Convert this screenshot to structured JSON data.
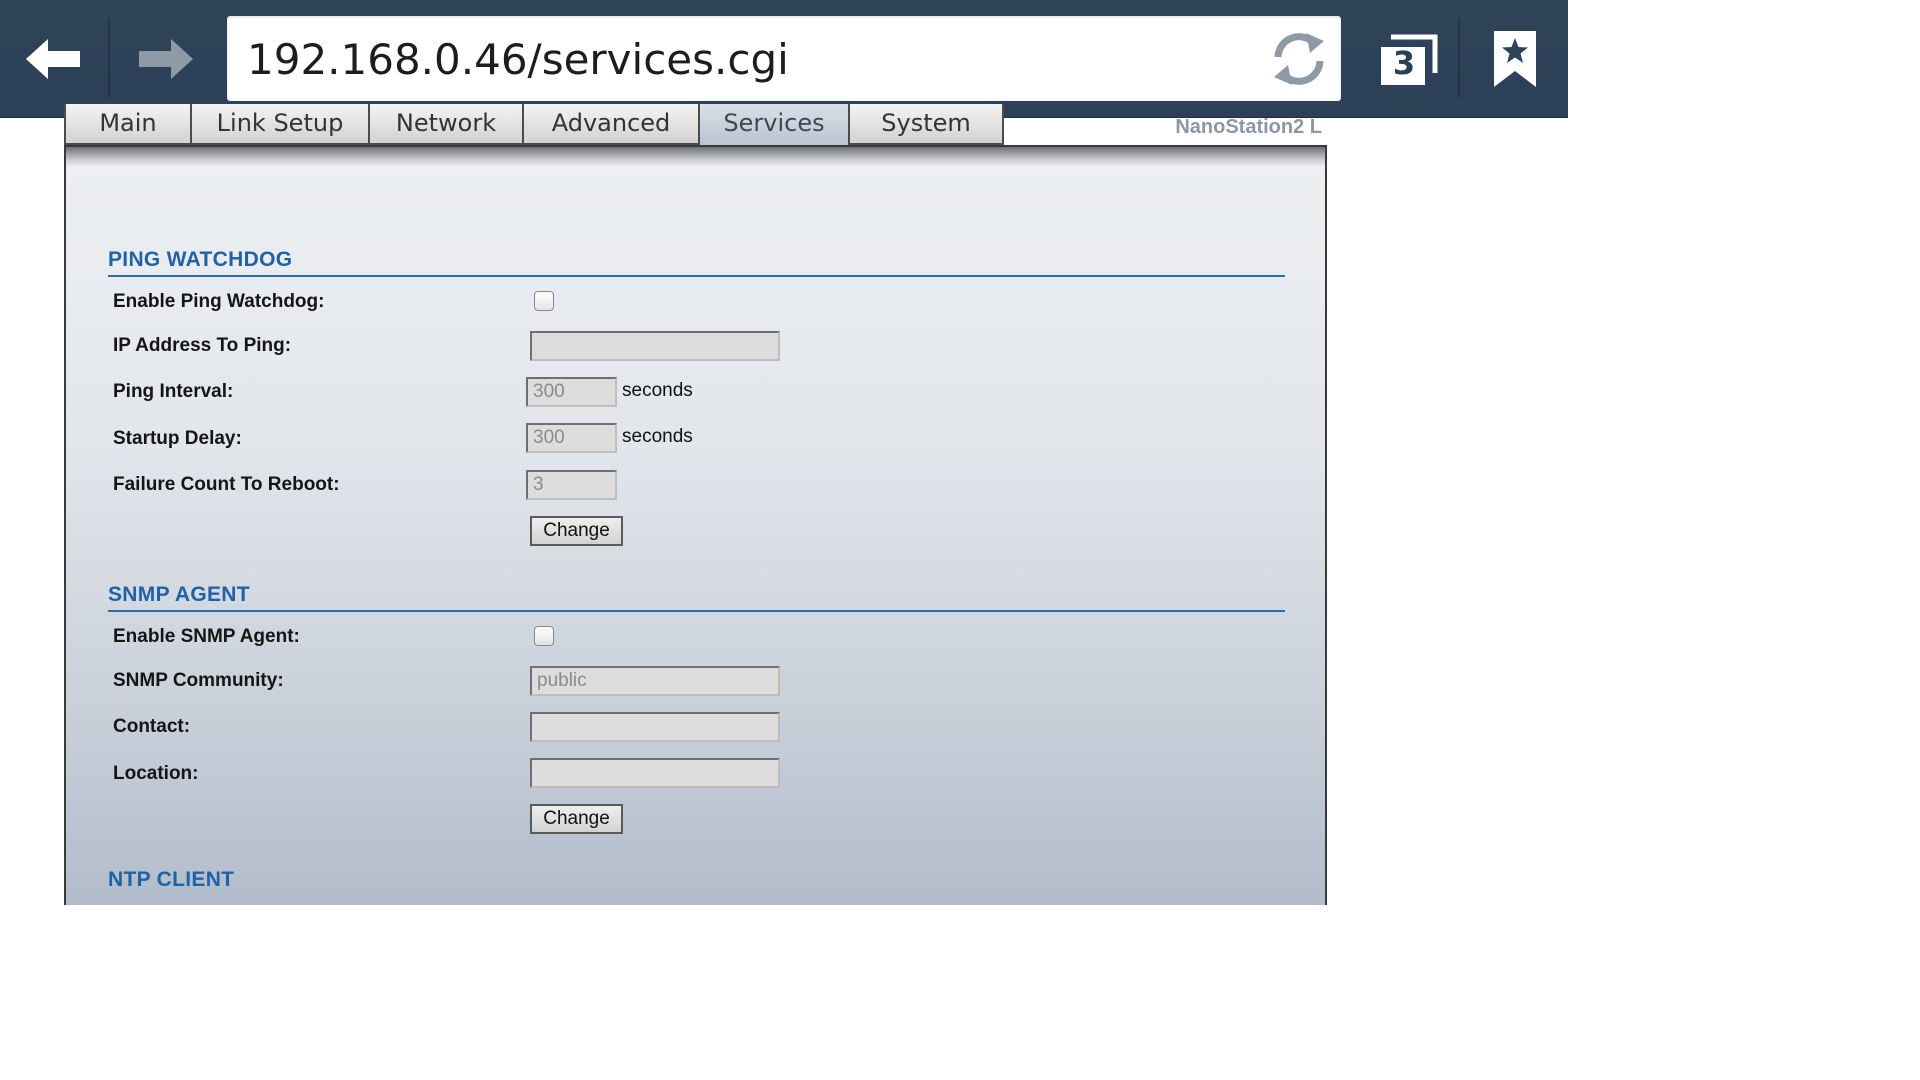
{
  "browser": {
    "url": "192.168.0.46/services.cgi",
    "tab_count": "3"
  },
  "nav_tabs": [
    {
      "label": "Main"
    },
    {
      "label": "Link Setup"
    },
    {
      "label": "Network"
    },
    {
      "label": "Advanced"
    },
    {
      "label": "Services",
      "active": true
    },
    {
      "label": "System"
    }
  ],
  "device_name": "NanoStation2 L",
  "ping_watchdog": {
    "title": "PING WATCHDOG",
    "enable_label": "Enable Ping Watchdog:",
    "enabled": false,
    "ip_label": "IP Address To Ping:",
    "ip_value": "",
    "interval_label": "Ping Interval:",
    "interval_value": "300",
    "interval_unit": "seconds",
    "delay_label": "Startup Delay:",
    "delay_value": "300",
    "delay_unit": "seconds",
    "failure_label": "Failure Count To Reboot:",
    "failure_value": "3",
    "change_label": "Change"
  },
  "snmp_agent": {
    "title": "SNMP AGENT",
    "enable_label": "Enable SNMP Agent:",
    "enabled": false,
    "community_label": "SNMP Community:",
    "community_value": "public",
    "contact_label": "Contact:",
    "contact_value": "",
    "location_label": "Location:",
    "location_value": "",
    "change_label": "Change"
  },
  "ntp_client": {
    "title": "NTP CLIENT"
  },
  "colors": {
    "toolbar": "#2f4459",
    "section_title": "#1f62a6",
    "device_name": "#8d97a3"
  }
}
